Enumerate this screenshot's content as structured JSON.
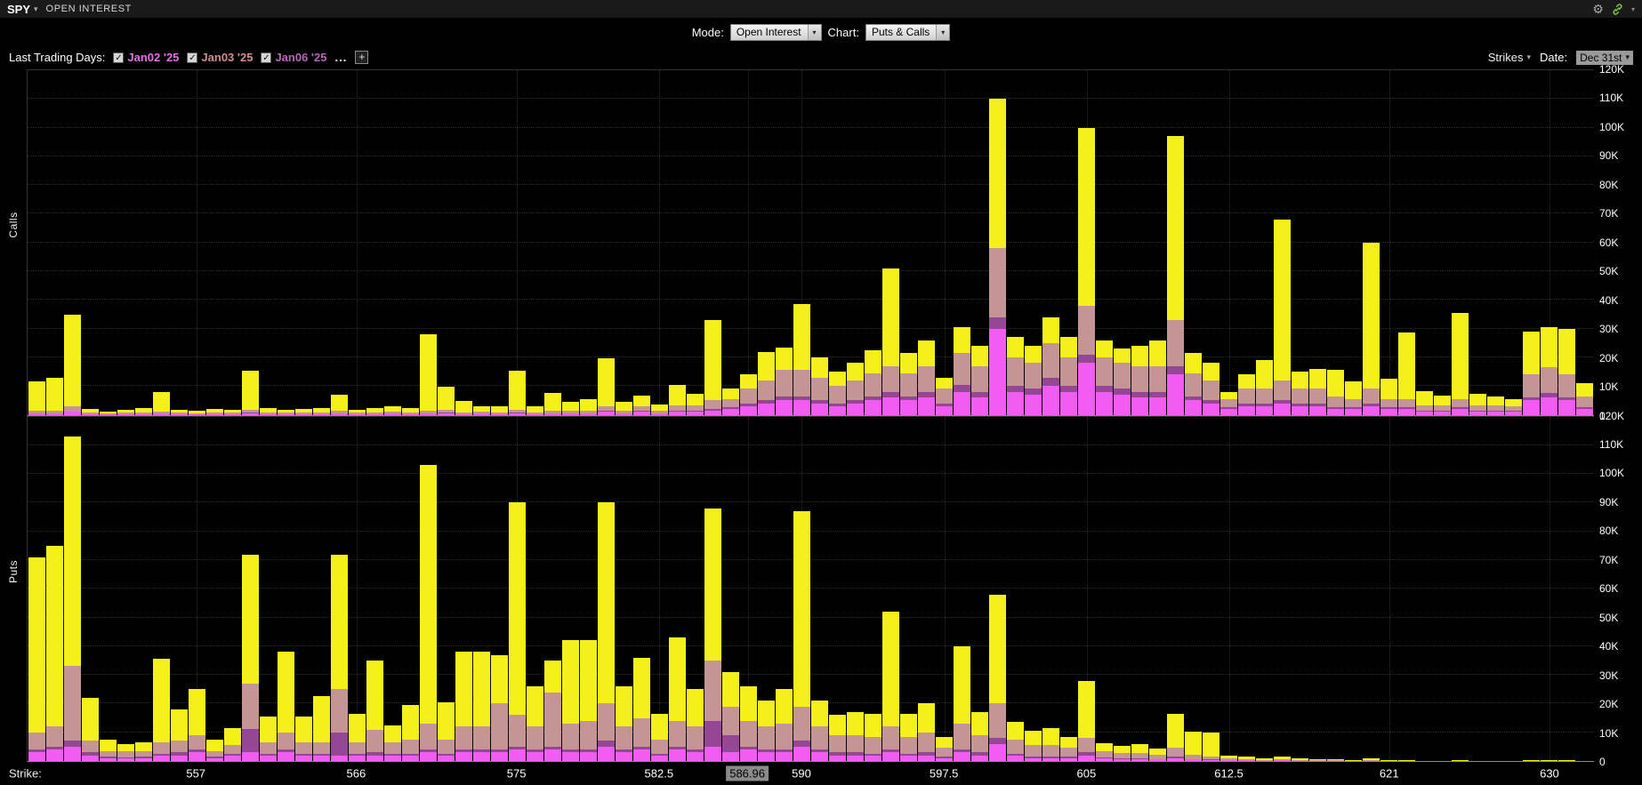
{
  "header": {
    "symbol": "SPY",
    "title": "OPEN INTEREST"
  },
  "icons": {
    "caret": "▾",
    "gear": "⚙",
    "check": "✓"
  },
  "toolbar": {
    "mode_label": "Mode:",
    "mode_value": "Open Interest",
    "chart_label": "Chart:",
    "chart_value": "Puts & Calls"
  },
  "filter_bar": {
    "label": "Last Trading Days:",
    "days": [
      {
        "label": "Jan02 '25",
        "checked": true,
        "color": "#e66ee6"
      },
      {
        "label": "Jan03 '25",
        "checked": true,
        "color": "#d48e8e"
      },
      {
        "label": "Jan06 '25",
        "checked": true,
        "color": "#b766b7"
      }
    ],
    "ellipsis": "...",
    "add_label": "+",
    "strikes_label": "Strikes",
    "date_label": "Date:",
    "date_value": "Dec 31st"
  },
  "bottom": {
    "strike_label": "Strike:"
  },
  "chart_data": {
    "type": "bar",
    "stacked": true,
    "title": "OPEN INTEREST",
    "xlabel": "Strike:",
    "units": "open interest contracts, values in thousands",
    "grid": true,
    "legend_position": "top-left-checkboxes",
    "ylim_k": [
      0,
      120
    ],
    "y_ticks": [
      "0",
      "10K",
      "20K",
      "30K",
      "40K",
      "50K",
      "60K",
      "70K",
      "80K",
      "90K",
      "100K",
      "110K",
      "120K"
    ],
    "panels": [
      {
        "name": "Calls"
      },
      {
        "name": "Puts"
      }
    ],
    "current_price": 586.96,
    "x_ticks": [
      {
        "value": 557,
        "label": "557"
      },
      {
        "value": 566,
        "label": "566"
      },
      {
        "value": 575,
        "label": "575"
      },
      {
        "value": 582.5,
        "label": "582.5"
      },
      {
        "value": 586.96,
        "label": "586.96",
        "highlight": true
      },
      {
        "value": 590,
        "label": "590"
      },
      {
        "value": 597.5,
        "label": "597.5"
      },
      {
        "value": 605,
        "label": "605"
      },
      {
        "value": 612.5,
        "label": "612.5"
      },
      {
        "value": 621,
        "label": "621"
      },
      {
        "value": 630,
        "label": "630"
      }
    ],
    "series": [
      {
        "name": "Jan02 '25",
        "color": "#f25cf2"
      },
      {
        "name": "Jan06 '25",
        "color": "#944794"
      },
      {
        "name": "Jan03 '25",
        "color": "#c59595"
      },
      {
        "name": "...",
        "color": "#f4f01c"
      }
    ],
    "stack_order": "bottom to top: Jan02, Jan06, Jan03, later expirations (yellow)",
    "strikes": [
      548,
      549,
      550,
      551,
      552,
      553,
      554,
      555,
      556,
      557,
      558,
      559,
      560,
      561,
      562,
      563,
      564,
      565,
      566,
      567,
      568,
      569,
      570,
      571,
      572,
      573,
      574,
      575,
      576,
      577,
      578,
      579,
      580,
      581,
      582,
      582.5,
      583,
      584,
      585,
      586,
      587,
      588,
      589,
      590,
      591,
      592,
      593,
      594,
      595,
      596,
      597,
      597.5,
      598,
      599,
      600,
      601,
      602,
      603,
      604,
      605,
      606,
      607,
      608,
      609,
      610,
      611,
      612,
      612.5,
      613,
      614,
      615,
      616,
      617,
      618,
      619,
      620,
      621,
      622,
      623,
      624,
      625,
      626,
      627,
      628,
      629,
      630,
      631,
      632
    ],
    "calls": [
      [
        0.5,
        0,
        1,
        10
      ],
      [
        0.5,
        0,
        1,
        11.5
      ],
      [
        1,
        0,
        2,
        32
      ],
      [
        0.3,
        0,
        0.5,
        1.2
      ],
      [
        0.2,
        0,
        0.3,
        0.7
      ],
      [
        0.3,
        0,
        0.5,
        1
      ],
      [
        0.3,
        0,
        0.5,
        1.5
      ],
      [
        0.5,
        0,
        0.5,
        7
      ],
      [
        0.3,
        0,
        0.5,
        1
      ],
      [
        0.2,
        0,
        0.3,
        0.8
      ],
      [
        0.3,
        0,
        0.5,
        1.2
      ],
      [
        0.3,
        0,
        0.5,
        1
      ],
      [
        0.5,
        0.2,
        1,
        13.5
      ],
      [
        0.3,
        0,
        0.5,
        1.5
      ],
      [
        0.3,
        0,
        0.5,
        1
      ],
      [
        0.3,
        0,
        0.5,
        1.2
      ],
      [
        0.3,
        0,
        0.5,
        1.5
      ],
      [
        0.5,
        0,
        1,
        5.5
      ],
      [
        0.3,
        0,
        0.5,
        1
      ],
      [
        0.3,
        0,
        0.5,
        1.5
      ],
      [
        0.5,
        0,
        0.5,
        2
      ],
      [
        0.3,
        0,
        0.5,
        1.5
      ],
      [
        0.5,
        0,
        1,
        26.5
      ],
      [
        0.5,
        0.2,
        1,
        8
      ],
      [
        0.3,
        0,
        0.5,
        4
      ],
      [
        0.5,
        0,
        0.5,
        2
      ],
      [
        0.3,
        0,
        0.5,
        2
      ],
      [
        0.5,
        0.2,
        1,
        13.5
      ],
      [
        0.3,
        0,
        0.5,
        2
      ],
      [
        0.5,
        0,
        1,
        6
      ],
      [
        0.5,
        0,
        1,
        3
      ],
      [
        0.5,
        0,
        1,
        4
      ],
      [
        1,
        0.3,
        1.5,
        17
      ],
      [
        0.5,
        0,
        1,
        3
      ],
      [
        1,
        0.3,
        1.5,
        4
      ],
      [
        0.5,
        0,
        1,
        2
      ],
      [
        1,
        0.3,
        2,
        7
      ],
      [
        1,
        0.3,
        2,
        4
      ],
      [
        1.5,
        0.5,
        3,
        28
      ],
      [
        2,
        0.5,
        3,
        3.5
      ],
      [
        3,
        1,
        5,
        5
      ],
      [
        4,
        1,
        7,
        10
      ],
      [
        5,
        1.5,
        9,
        8
      ],
      [
        5,
        1.5,
        9,
        23
      ],
      [
        4,
        1,
        8,
        7
      ],
      [
        3,
        1,
        6,
        5
      ],
      [
        4,
        1,
        7,
        6
      ],
      [
        5,
        1.5,
        8,
        8
      ],
      [
        6,
        2,
        9,
        34
      ],
      [
        5,
        1.5,
        8,
        7
      ],
      [
        6,
        2,
        9,
        9
      ],
      [
        3,
        1,
        5,
        4
      ],
      [
        8,
        2.5,
        11,
        9
      ],
      [
        6,
        2,
        9,
        7
      ],
      [
        30,
        4,
        24,
        52
      ],
      [
        8,
        2,
        10,
        7
      ],
      [
        7,
        2,
        9,
        6
      ],
      [
        10,
        3,
        12,
        9
      ],
      [
        8,
        2,
        10,
        7
      ],
      [
        18,
        3,
        17,
        62
      ],
      [
        8,
        2,
        10,
        6
      ],
      [
        7,
        2,
        9,
        5
      ],
      [
        6,
        2,
        9,
        7
      ],
      [
        6,
        2,
        9,
        9
      ],
      [
        14,
        3,
        16,
        64
      ],
      [
        5,
        1.5,
        8,
        7
      ],
      [
        4,
        1,
        7,
        6
      ],
      [
        2,
        0.5,
        3,
        2.5
      ],
      [
        3,
        1,
        5,
        5
      ],
      [
        3,
        1,
        5,
        10
      ],
      [
        4,
        1,
        7,
        56
      ],
      [
        3,
        1,
        5,
        6
      ],
      [
        3,
        1,
        5,
        7
      ],
      [
        2,
        0.5,
        4,
        9
      ],
      [
        2,
        0.5,
        3,
        6
      ],
      [
        3,
        1,
        5,
        51
      ],
      [
        2,
        0.5,
        3,
        7
      ],
      [
        2,
        0.5,
        3,
        23
      ],
      [
        1,
        0.3,
        2,
        5
      ],
      [
        1,
        0.3,
        2,
        3.5
      ],
      [
        2,
        0.5,
        3,
        30
      ],
      [
        1,
        0.3,
        2,
        4
      ],
      [
        1,
        0.3,
        2,
        3
      ],
      [
        1,
        0.3,
        1.5,
        2.5
      ],
      [
        5,
        1,
        8,
        15
      ],
      [
        6,
        1.5,
        9,
        14
      ],
      [
        5,
        1,
        8,
        16
      ],
      [
        2,
        0.5,
        4,
        4.5
      ]
    ],
    "puts": [
      [
        3,
        1,
        6,
        61
      ],
      [
        4,
        1,
        7,
        63
      ],
      [
        5,
        2,
        26,
        80
      ],
      [
        2,
        1,
        4,
        15
      ],
      [
        1,
        0.5,
        2,
        4
      ],
      [
        1,
        0.3,
        2,
        2.5
      ],
      [
        1,
        0.5,
        2,
        3
      ],
      [
        2,
        0.5,
        4,
        29
      ],
      [
        2,
        1,
        4,
        11
      ],
      [
        3,
        1,
        5,
        16
      ],
      [
        1,
        0.5,
        2,
        4
      ],
      [
        2,
        0.5,
        3,
        6
      ],
      [
        3,
        8,
        16,
        45
      ],
      [
        2,
        0.5,
        4,
        9
      ],
      [
        3,
        1,
        6,
        28
      ],
      [
        2,
        0.5,
        4,
        9
      ],
      [
        2,
        0.5,
        4,
        16
      ],
      [
        2,
        8,
        15,
        47
      ],
      [
        2,
        0.5,
        4,
        10
      ],
      [
        2,
        1,
        8,
        24
      ],
      [
        2,
        0.5,
        4,
        6
      ],
      [
        2,
        0.5,
        5,
        12
      ],
      [
        3,
        1,
        9,
        90
      ],
      [
        2,
        0.5,
        5,
        13
      ],
      [
        3,
        1,
        8,
        26
      ],
      [
        3,
        1,
        8,
        26
      ],
      [
        3,
        1,
        16,
        17
      ],
      [
        4,
        1,
        11,
        74
      ],
      [
        3,
        1,
        8,
        14
      ],
      [
        4,
        1,
        19,
        11
      ],
      [
        3,
        1,
        9,
        29
      ],
      [
        3,
        1,
        10,
        28
      ],
      [
        5,
        2,
        13,
        70
      ],
      [
        3,
        1,
        8,
        14
      ],
      [
        4,
        1,
        10,
        21
      ],
      [
        2,
        0.5,
        5,
        9
      ],
      [
        4,
        1,
        9,
        29
      ],
      [
        3,
        1,
        8,
        13
      ],
      [
        5,
        9,
        21,
        53
      ],
      [
        3,
        6,
        10,
        12
      ],
      [
        4,
        1,
        9,
        12
      ],
      [
        3,
        1,
        8,
        9
      ],
      [
        3,
        1,
        9,
        12
      ],
      [
        5,
        2,
        12,
        68
      ],
      [
        3,
        1,
        8,
        9
      ],
      [
        2,
        1,
        6,
        7
      ],
      [
        2,
        1,
        6,
        8
      ],
      [
        2,
        0.5,
        6,
        8
      ],
      [
        3,
        1,
        8,
        40
      ],
      [
        2,
        0.5,
        6,
        8
      ],
      [
        2,
        1,
        7,
        10
      ],
      [
        1,
        0.5,
        3,
        4
      ],
      [
        3,
        1,
        9,
        27
      ],
      [
        2,
        1,
        6,
        8
      ],
      [
        6,
        2,
        12,
        38
      ],
      [
        2,
        0.5,
        5,
        6
      ],
      [
        1,
        0.5,
        4,
        5
      ],
      [
        1,
        0.5,
        4,
        6
      ],
      [
        1,
        0.5,
        3,
        4
      ],
      [
        2,
        1,
        5,
        20
      ],
      [
        1,
        0.3,
        2,
        3
      ],
      [
        0.5,
        0.3,
        2,
        2.5
      ],
      [
        0.5,
        0.3,
        2,
        3
      ],
      [
        0.5,
        0.2,
        1.5,
        2
      ],
      [
        1,
        0.5,
        3,
        12
      ],
      [
        0.5,
        0.2,
        1.5,
        8
      ],
      [
        0.3,
        0.2,
        1,
        8.5
      ],
      [
        0.2,
        0.1,
        0.5,
        1
      ],
      [
        0.2,
        0,
        0.5,
        0.8
      ],
      [
        0.1,
        0,
        0.3,
        0.6
      ],
      [
        0.2,
        0,
        0.5,
        1
      ],
      [
        0.1,
        0,
        0.3,
        0.4
      ],
      [
        0.1,
        0,
        0.2,
        0.3
      ],
      [
        0.1,
        0,
        0.2,
        0.3
      ],
      [
        0,
        0,
        0.1,
        0.2
      ],
      [
        0.1,
        0,
        0.2,
        0.5
      ],
      [
        0,
        0,
        0.1,
        0.2
      ],
      [
        0,
        0,
        0.1,
        0.2
      ],
      [
        0,
        0,
        0,
        0.1
      ],
      [
        0,
        0,
        0,
        0.1
      ],
      [
        0,
        0,
        0.1,
        0.3
      ],
      [
        0,
        0,
        0,
        0.1
      ],
      [
        0,
        0,
        0,
        0.1
      ],
      [
        0,
        0,
        0,
        0.1
      ],
      [
        0,
        0,
        0,
        0.2
      ],
      [
        0,
        0,
        0.1,
        0.3
      ],
      [
        0,
        0,
        0,
        0.2
      ],
      [
        0,
        0,
        0,
        0.1
      ]
    ]
  }
}
